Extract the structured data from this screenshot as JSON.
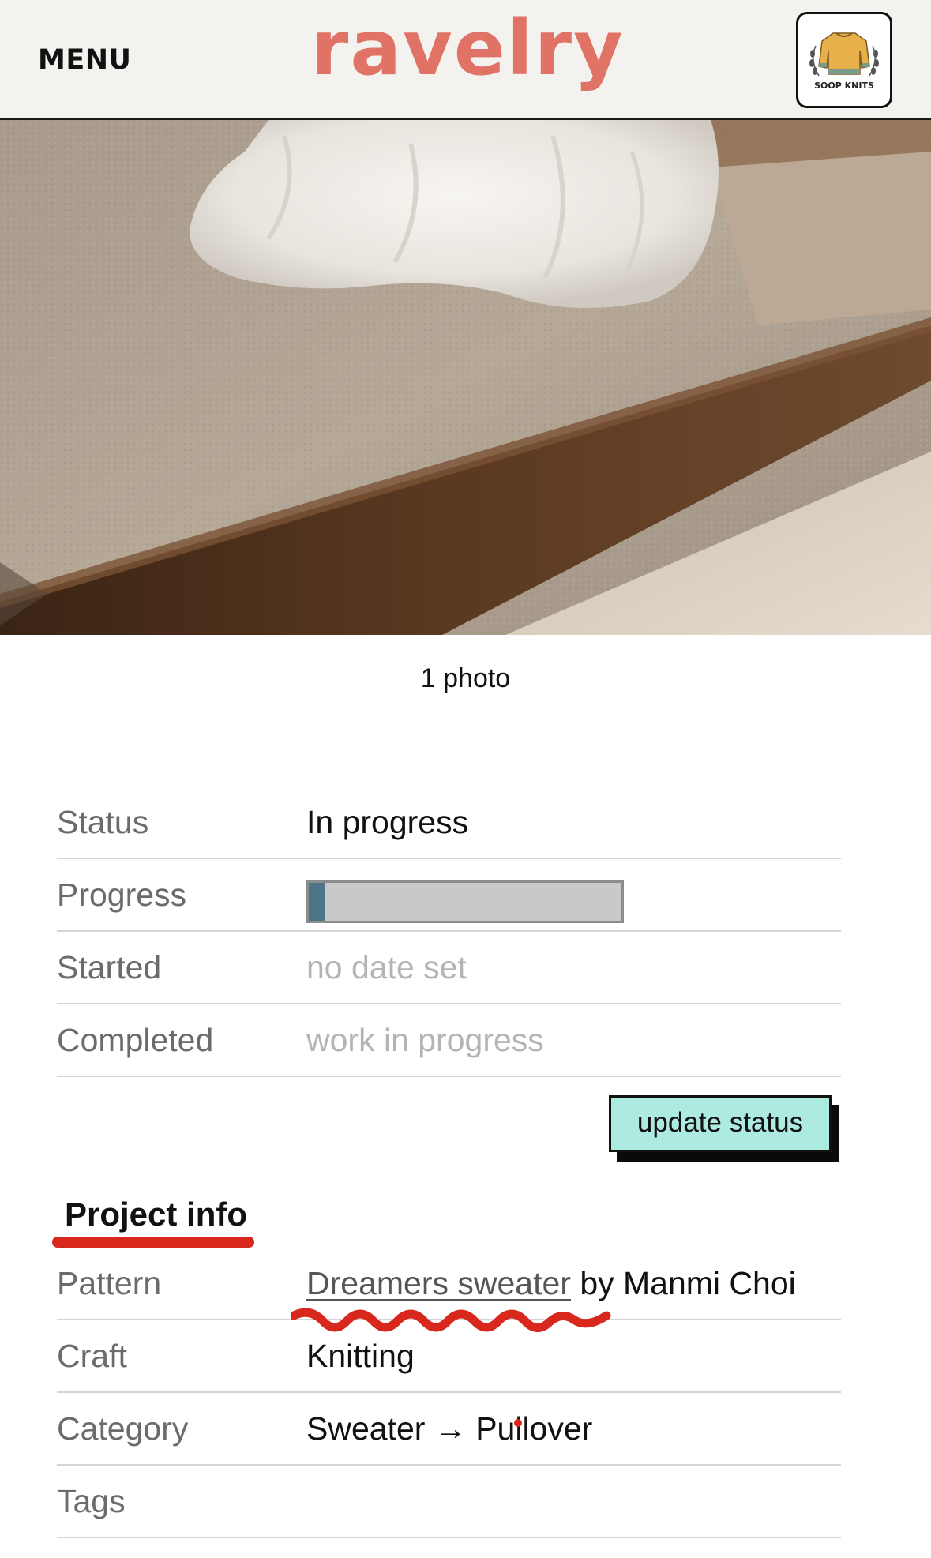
{
  "header": {
    "menu_label": "MENU",
    "logo_text": "ravelry",
    "avatar": {
      "icon": "sweater-icon",
      "label": "SOOP KNITS",
      "sweater_color": "#e8b04a"
    }
  },
  "gallery": {
    "photo_count": "1 photo"
  },
  "status_table": {
    "rows": [
      {
        "label": "Status",
        "value": "In progress"
      },
      {
        "label": "Progress",
        "value_fraction": 0.05
      },
      {
        "label": "Started",
        "value": "no date set"
      },
      {
        "label": "Completed",
        "value": "work in progress"
      }
    ],
    "update_button": "update status"
  },
  "project_info": {
    "title": "Project info",
    "rows": [
      {
        "label": "Pattern",
        "link": "Dreamers sweater",
        "suffix": " by Manmi Choi"
      },
      {
        "label": "Craft",
        "value": "Knitting"
      },
      {
        "label": "Category",
        "value": "Sweater → Pullover"
      },
      {
        "label": "Tags",
        "value": ""
      }
    ]
  },
  "colors": {
    "brand": "#e07366",
    "progress_fill": "#4e7585",
    "button_bg": "#adeadf",
    "annotation": "#d8281e"
  }
}
